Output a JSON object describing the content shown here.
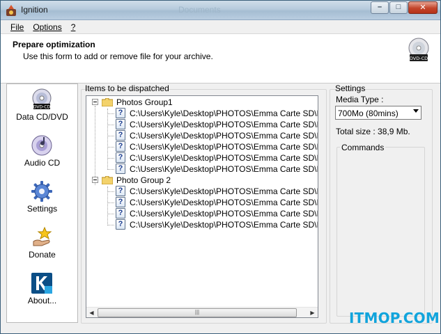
{
  "window": {
    "title": "Ignition",
    "background_title": "Documents",
    "controls": {
      "minimize": "–",
      "maximize": "□",
      "close": "✕"
    }
  },
  "menu": {
    "items": [
      "File",
      "Options",
      "?"
    ]
  },
  "header": {
    "title": "Prepare optimization",
    "subtitle": "Use this form to add or remove file for your archive.",
    "icon": "dvd-cd-icon",
    "icon_text": "DVD-CD"
  },
  "nav": {
    "items": [
      {
        "label": "Data CD/DVD",
        "icon": "data-disc-icon"
      },
      {
        "label": "Audio CD",
        "icon": "audio-disc-icon"
      },
      {
        "label": "Settings",
        "icon": "gear-icon"
      },
      {
        "label": "Donate",
        "icon": "donate-star-icon"
      },
      {
        "label": "About...",
        "icon": "about-k-icon"
      }
    ],
    "disc_text": "DVD-CD"
  },
  "items": {
    "label": "Items to be dispatched",
    "groups": [
      {
        "name": "Photos Group1",
        "files": [
          "C:\\Users\\Kyle\\Desktop\\PHOTOS\\Emma Carte SD\\IMG_",
          "C:\\Users\\Kyle\\Desktop\\PHOTOS\\Emma Carte SD\\IMG_",
          "C:\\Users\\Kyle\\Desktop\\PHOTOS\\Emma Carte SD\\IMG_",
          "C:\\Users\\Kyle\\Desktop\\PHOTOS\\Emma Carte SD\\IMG_",
          "C:\\Users\\Kyle\\Desktop\\PHOTOS\\Emma Carte SD\\IMG_",
          "C:\\Users\\Kyle\\Desktop\\PHOTOS\\Emma Carte SD\\IMG_"
        ]
      },
      {
        "name": "Photo Group 2",
        "files": [
          "C:\\Users\\Kyle\\Desktop\\PHOTOS\\Emma Carte SD\\IMG_",
          "C:\\Users\\Kyle\\Desktop\\PHOTOS\\Emma Carte SD\\IMG_",
          "C:\\Users\\Kyle\\Desktop\\PHOTOS\\Emma Carte SD\\IMG_",
          "C:\\Users\\Kyle\\Desktop\\PHOTOS\\Emma Carte SD\\IMG_"
        ]
      }
    ],
    "expander_symbol": "−",
    "file_icon_symbol": "?",
    "scroll_left": "◀",
    "scroll_right": "▶",
    "scroll_grip": "|||"
  },
  "settings": {
    "label": "Settings",
    "media_type_label": "Media Type :",
    "media_type_value": "700Mo (80mins)",
    "total_size": "Total size : 38,9 Mb.",
    "commands_label": "Commands"
  },
  "watermark": "ITMOP.COM",
  "colors": {
    "accent": "#11a4dc",
    "titlebar": "#b6cbdc",
    "close": "#c3452b"
  }
}
